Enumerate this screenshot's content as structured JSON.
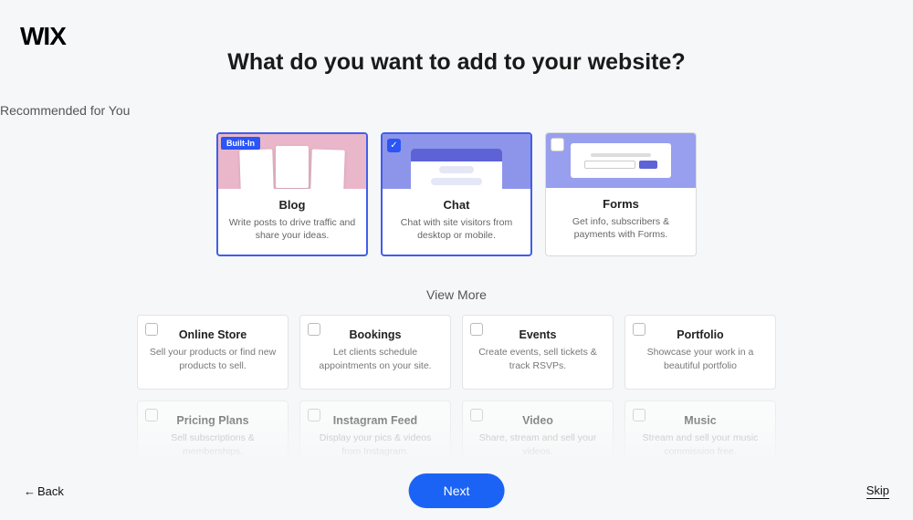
{
  "logo": "WIX",
  "title": "What do you want to add to your website?",
  "recommended_label": "Recommended for You",
  "viewmore_label": "View More",
  "builtin_badge": "Built-In",
  "recommended": [
    {
      "title": "Blog",
      "desc": "Write posts to drive traffic and share your ideas.",
      "builtin": true,
      "checked": false
    },
    {
      "title": "Chat",
      "desc": "Chat with site visitors from desktop or mobile.",
      "builtin": false,
      "checked": true
    },
    {
      "title": "Forms",
      "desc": "Get info, subscribers & payments with Forms.",
      "builtin": false,
      "checked": false
    }
  ],
  "more": [
    {
      "title": "Online Store",
      "desc": "Sell your products or find new products to sell."
    },
    {
      "title": "Bookings",
      "desc": "Let clients schedule appointments on your site."
    },
    {
      "title": "Events",
      "desc": "Create events, sell tickets & track RSVPs."
    },
    {
      "title": "Portfolio",
      "desc": "Showcase your work in a beautiful portfolio"
    },
    {
      "title": "Pricing Plans",
      "desc": "Sell subscriptions & memberships."
    },
    {
      "title": "Instagram Feed",
      "desc": "Display your pics & videos from Instagram."
    },
    {
      "title": "Video",
      "desc": "Share, stream and sell your videos."
    },
    {
      "title": "Music",
      "desc": "Stream and sell your music commission free."
    }
  ],
  "footer": {
    "back": "Back",
    "next": "Next",
    "skip": "Skip"
  }
}
